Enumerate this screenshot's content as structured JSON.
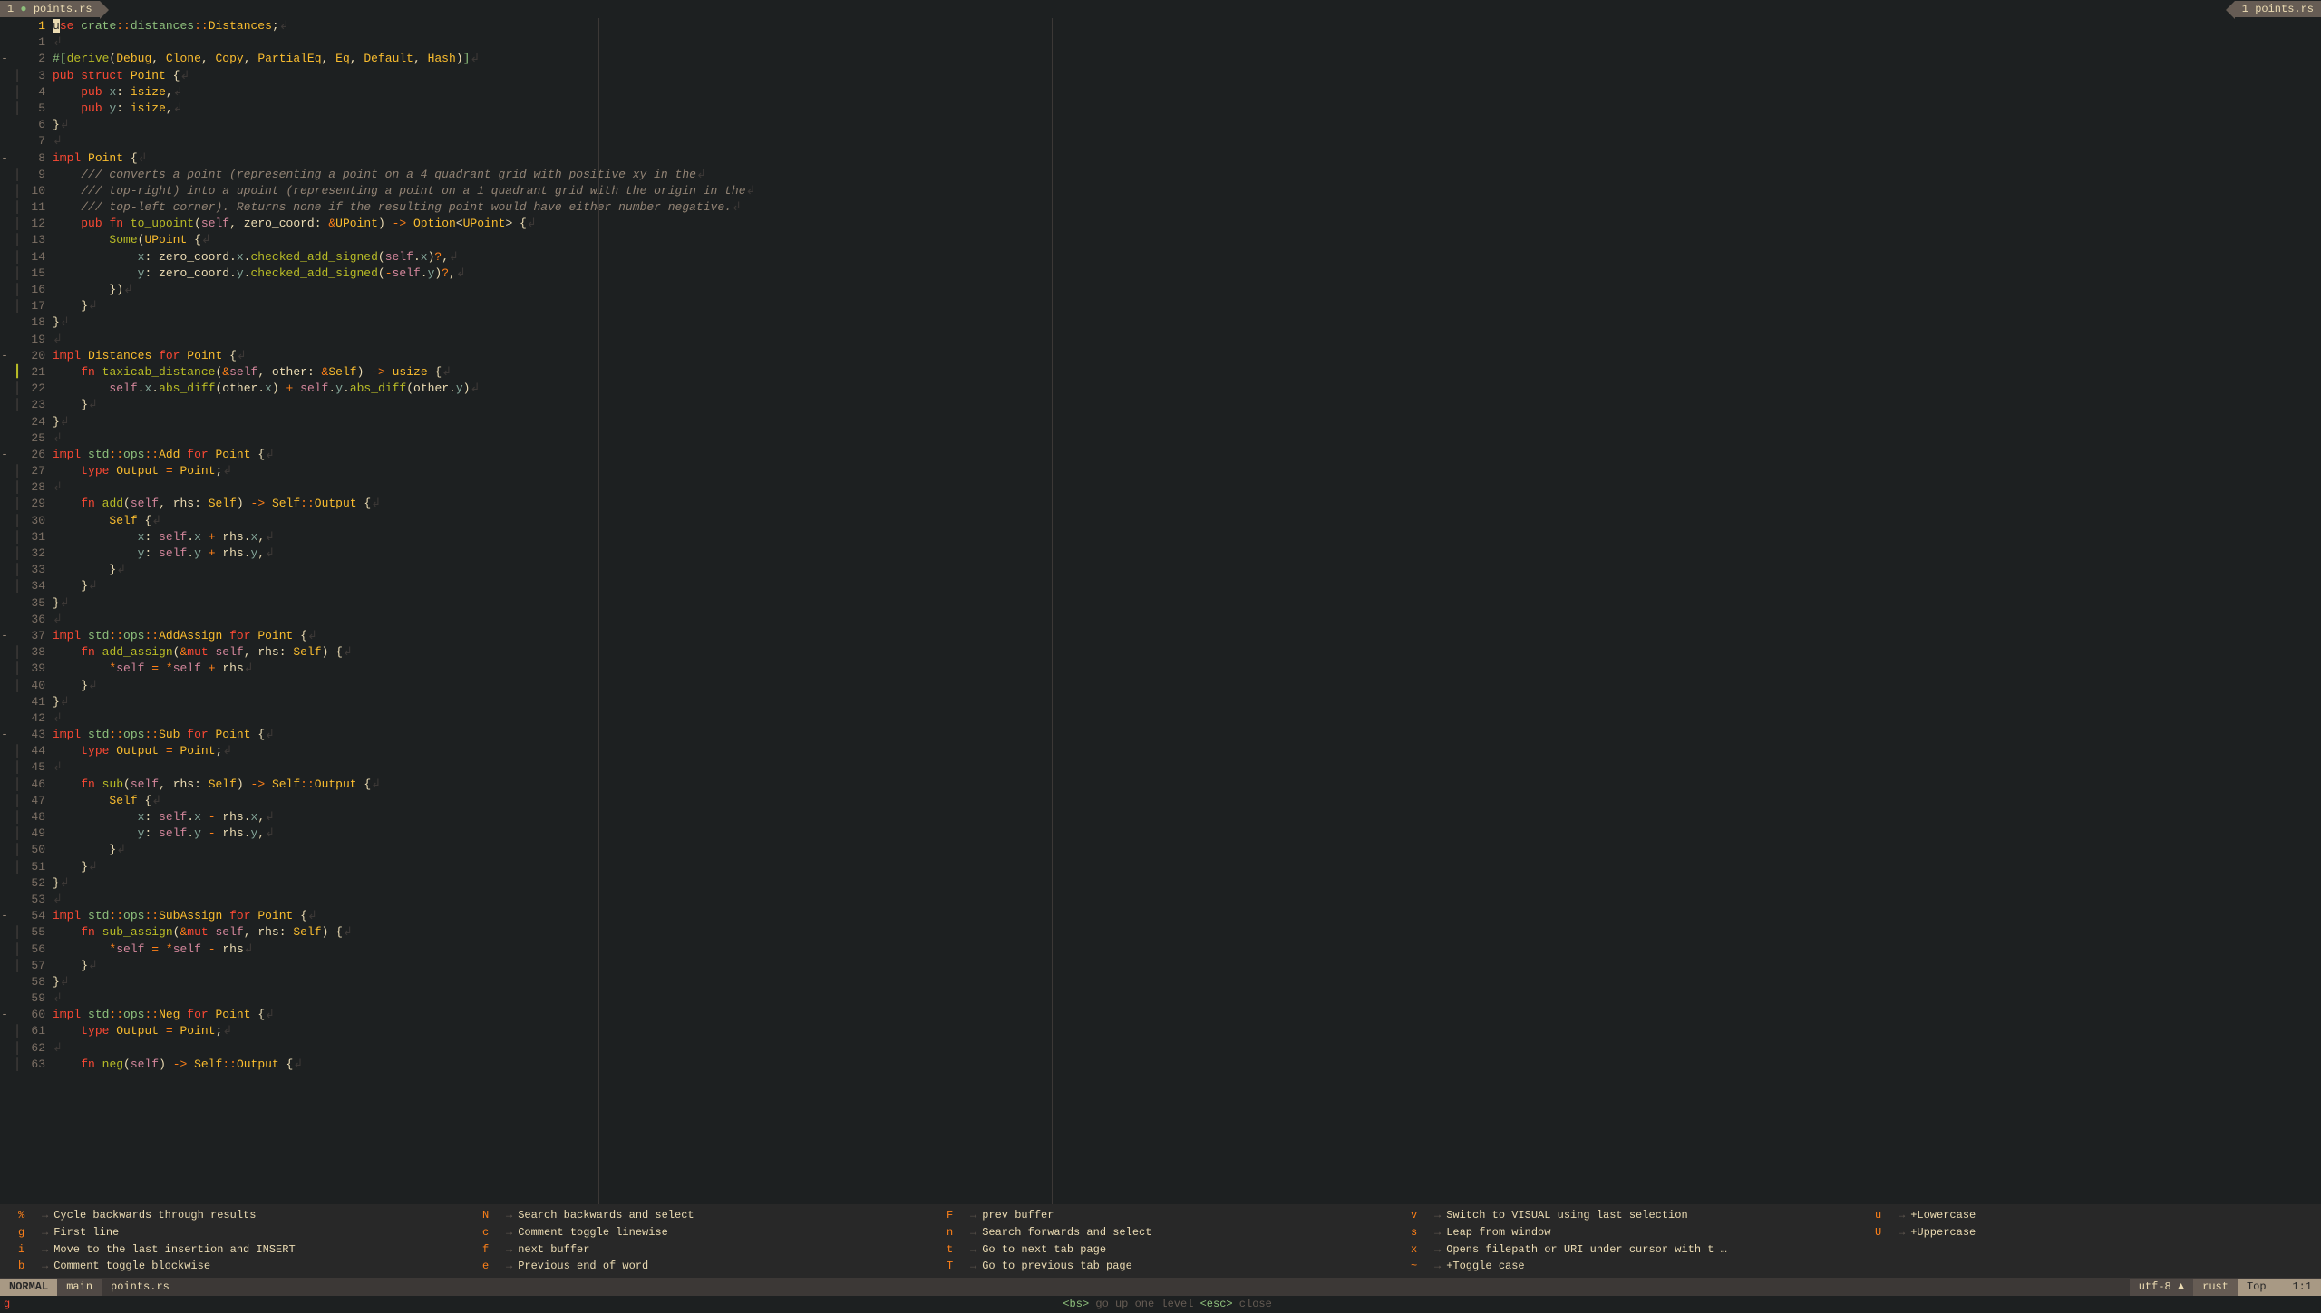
{
  "bufferline": {
    "left": {
      "index": "1",
      "modified": "●",
      "name": "points.rs"
    },
    "right": {
      "index": "1",
      "name": "points.rs"
    }
  },
  "code_lines": [
    {
      "n": 1,
      "fold": "",
      "sign": "",
      "html": "<span class='cursor-block'>u</span><span class='kw'>se</span> <span class='ns'>crate</span><span class='op'>::</span><span class='ns'>distances</span><span class='op'>::</span><span class='ty'>Distances</span>;<span class='ws'>↲</span>",
      "current": true
    },
    {
      "n": 1,
      "rel": true,
      "fold": "",
      "sign": "",
      "html": "<span class='ws'>↲</span>"
    },
    {
      "n": 2,
      "rel": true,
      "fold": "-",
      "sign": "",
      "html": "<span class='attr'>#[</span><span class='fn'>derive</span>(<span class='ty'>Debug</span>, <span class='ty'>Clone</span>, <span class='ty'>Copy</span>, <span class='ty'>PartialEq</span>, <span class='ty'>Eq</span>, <span class='ty'>Default</span>, <span class='ty'>Hash</span>)<span class='attr'>]</span><span class='ws'>↲</span>"
    },
    {
      "n": 3,
      "rel": true,
      "fold": "",
      "sign": "│",
      "html": "<span class='kw'>pub</span> <span class='kw'>struct</span> <span class='ty'>Point</span> {<span class='ws'>↲</span>"
    },
    {
      "n": 4,
      "rel": true,
      "fold": "",
      "sign": "│",
      "html": "    <span class='kw'>pub</span> <span class='prop'>x</span>: <span class='ty'>isize</span>,<span class='ws'>↲</span>"
    },
    {
      "n": 5,
      "rel": true,
      "fold": "",
      "sign": "│",
      "html": "    <span class='kw'>pub</span> <span class='prop'>y</span>: <span class='ty'>isize</span>,<span class='ws'>↲</span>"
    },
    {
      "n": 6,
      "rel": true,
      "fold": "",
      "sign": "",
      "html": "}<span class='ws'>↲</span>"
    },
    {
      "n": 7,
      "rel": true,
      "fold": "",
      "sign": "",
      "html": "<span class='ws'>↲</span>"
    },
    {
      "n": 8,
      "rel": true,
      "fold": "-",
      "sign": "",
      "html": "<span class='kw'>impl</span> <span class='ty'>Point</span> {<span class='ws'>↲</span>"
    },
    {
      "n": 9,
      "rel": true,
      "fold": "",
      "sign": "│",
      "html": "    <span class='comment'>/// converts a point (representing a point on a 4 quadrant grid with positive xy in the</span><span class='ws'>↲</span>"
    },
    {
      "n": 10,
      "rel": true,
      "fold": "",
      "sign": "│",
      "html": "    <span class='comment'>/// top-right) into a upoint (representing a point on a 1 quadrant grid with the origin in the</span><span class='ws'>↲</span>"
    },
    {
      "n": 11,
      "rel": true,
      "fold": "",
      "sign": "│",
      "html": "    <span class='comment'>/// top-left corner). Returns none if the resulting point would have either number negative.</span><span class='ws'>↲</span>"
    },
    {
      "n": 12,
      "rel": true,
      "fold": "",
      "sign": "│",
      "html": "    <span class='kw'>pub</span> <span class='kw'>fn</span> <span class='fn'>to_upoint</span>(<span class='self'>self</span>, <span class='param'>zero_coord</span>: <span class='op'>&</span><span class='ty'>UPoint</span>) <span class='op'>-&gt;</span> <span class='ty'>Option</span>&lt;<span class='ty'>UPoint</span>&gt; {<span class='ws'>↲</span>"
    },
    {
      "n": 13,
      "rel": true,
      "fold": "",
      "sign": "│",
      "html": "        <span class='fn'>Some</span>(<span class='ty'>UPoint</span> {<span class='ws'>↲</span>"
    },
    {
      "n": 14,
      "rel": true,
      "fold": "",
      "sign": "│",
      "html": "            <span class='prop'>x</span>: zero_coord.<span class='prop'>x</span>.<span class='fn'>checked_add_signed</span>(<span class='self'>self</span>.<span class='prop'>x</span>)<span class='op'>?</span>,<span class='ws'>↲</span>"
    },
    {
      "n": 15,
      "rel": true,
      "fold": "",
      "sign": "│",
      "html": "            <span class='prop'>y</span>: zero_coord.<span class='prop'>y</span>.<span class='fn'>checked_add_signed</span>(<span class='op'>-</span><span class='self'>self</span>.<span class='prop'>y</span>)<span class='op'>?</span>,<span class='ws'>↲</span>"
    },
    {
      "n": 16,
      "rel": true,
      "fold": "",
      "sign": "│",
      "html": "        })<span class='ws'>↲</span>"
    },
    {
      "n": 17,
      "rel": true,
      "fold": "",
      "sign": "│",
      "html": "    }<span class='ws'>↲</span>"
    },
    {
      "n": 18,
      "rel": true,
      "fold": "",
      "sign": "",
      "html": "}<span class='ws'>↲</span>"
    },
    {
      "n": 19,
      "rel": true,
      "fold": "",
      "sign": "",
      "html": "<span class='ws'>↲</span>"
    },
    {
      "n": 20,
      "rel": true,
      "fold": "-",
      "sign": "",
      "html": "<span class='kw'>impl</span> <span class='ty'>Distances</span> <span class='kw'>for</span> <span class='ty'>Point</span> {<span class='ws'>↲</span>"
    },
    {
      "n": 21,
      "rel": true,
      "fold": "",
      "sign": "┃",
      "sigclass": "git-add",
      "html": "    <span class='kw'>fn</span> <span class='fn'>taxicab_distance</span>(<span class='op'>&</span><span class='self'>self</span>, <span class='param'>other</span>: <span class='op'>&</span><span class='ty'>Self</span>) <span class='op'>-&gt;</span> <span class='ty'>usize</span> {<span class='ws'>↲</span>"
    },
    {
      "n": 22,
      "rel": true,
      "fold": "",
      "sign": "│",
      "html": "        <span class='self'>self</span>.<span class='prop'>x</span>.<span class='fn'>abs_diff</span>(other.<span class='prop'>x</span>) <span class='op'>+</span> <span class='self'>self</span>.<span class='prop'>y</span>.<span class='fn'>abs_diff</span>(other.<span class='prop'>y</span>)<span class='ws'>↲</span>"
    },
    {
      "n": 23,
      "rel": true,
      "fold": "",
      "sign": "│",
      "html": "    }<span class='ws'>↲</span>"
    },
    {
      "n": 24,
      "rel": true,
      "fold": "",
      "sign": "",
      "html": "}<span class='ws'>↲</span>"
    },
    {
      "n": 25,
      "rel": true,
      "fold": "",
      "sign": "",
      "html": "<span class='ws'>↲</span>"
    },
    {
      "n": 26,
      "rel": true,
      "fold": "-",
      "sign": "",
      "html": "<span class='kw'>impl</span> <span class='ns'>std</span><span class='op'>::</span><span class='ns'>ops</span><span class='op'>::</span><span class='ty'>Add</span> <span class='kw'>for</span> <span class='ty'>Point</span> {<span class='ws'>↲</span>"
    },
    {
      "n": 27,
      "rel": true,
      "fold": "",
      "sign": "│",
      "html": "    <span class='kw'>type</span> <span class='ty'>Output</span> <span class='op'>=</span> <span class='ty'>Point</span>;<span class='ws'>↲</span>"
    },
    {
      "n": 28,
      "rel": true,
      "fold": "",
      "sign": "│",
      "html": "<span class='ws'>↲</span>"
    },
    {
      "n": 29,
      "rel": true,
      "fold": "",
      "sign": "│",
      "html": "    <span class='kw'>fn</span> <span class='fn'>add</span>(<span class='self'>self</span>, <span class='param'>rhs</span>: <span class='ty'>Self</span>) <span class='op'>-&gt;</span> <span class='ty'>Self</span><span class='op'>::</span><span class='ty'>Output</span> {<span class='ws'>↲</span>"
    },
    {
      "n": 30,
      "rel": true,
      "fold": "",
      "sign": "│",
      "html": "        <span class='ty'>Self</span> {<span class='ws'>↲</span>"
    },
    {
      "n": 31,
      "rel": true,
      "fold": "",
      "sign": "│",
      "html": "            <span class='prop'>x</span>: <span class='self'>self</span>.<span class='prop'>x</span> <span class='op'>+</span> rhs.<span class='prop'>x</span>,<span class='ws'>↲</span>"
    },
    {
      "n": 32,
      "rel": true,
      "fold": "",
      "sign": "│",
      "html": "            <span class='prop'>y</span>: <span class='self'>self</span>.<span class='prop'>y</span> <span class='op'>+</span> rhs.<span class='prop'>y</span>,<span class='ws'>↲</span>"
    },
    {
      "n": 33,
      "rel": true,
      "fold": "",
      "sign": "│",
      "html": "        }<span class='ws'>↲</span>"
    },
    {
      "n": 34,
      "rel": true,
      "fold": "",
      "sign": "│",
      "html": "    }<span class='ws'>↲</span>"
    },
    {
      "n": 35,
      "rel": true,
      "fold": "",
      "sign": "",
      "html": "}<span class='ws'>↲</span>"
    },
    {
      "n": 36,
      "rel": true,
      "fold": "",
      "sign": "",
      "html": "<span class='ws'>↲</span>"
    },
    {
      "n": 37,
      "rel": true,
      "fold": "-",
      "sign": "",
      "html": "<span class='kw'>impl</span> <span class='ns'>std</span><span class='op'>::</span><span class='ns'>ops</span><span class='op'>::</span><span class='ty'>AddAssign</span> <span class='kw'>for</span> <span class='ty'>Point</span> {<span class='ws'>↲</span>"
    },
    {
      "n": 38,
      "rel": true,
      "fold": "",
      "sign": "│",
      "html": "    <span class='kw'>fn</span> <span class='fn'>add_assign</span>(<span class='op'>&</span><span class='kw'>mut</span> <span class='self'>self</span>, <span class='param'>rhs</span>: <span class='ty'>Self</span>) {<span class='ws'>↲</span>"
    },
    {
      "n": 39,
      "rel": true,
      "fold": "",
      "sign": "│",
      "html": "        <span class='op'>*</span><span class='self'>self</span> <span class='op'>=</span> <span class='op'>*</span><span class='self'>self</span> <span class='op'>+</span> rhs<span class='ws'>↲</span>"
    },
    {
      "n": 40,
      "rel": true,
      "fold": "",
      "sign": "│",
      "html": "    }<span class='ws'>↲</span>"
    },
    {
      "n": 41,
      "rel": true,
      "fold": "",
      "sign": "",
      "html": "}<span class='ws'>↲</span>"
    },
    {
      "n": 42,
      "rel": true,
      "fold": "",
      "sign": "",
      "html": "<span class='ws'>↲</span>"
    },
    {
      "n": 43,
      "rel": true,
      "fold": "-",
      "sign": "",
      "html": "<span class='kw'>impl</span> <span class='ns'>std</span><span class='op'>::</span><span class='ns'>ops</span><span class='op'>::</span><span class='ty'>Sub</span> <span class='kw'>for</span> <span class='ty'>Point</span> {<span class='ws'>↲</span>"
    },
    {
      "n": 44,
      "rel": true,
      "fold": "",
      "sign": "│",
      "html": "    <span class='kw'>type</span> <span class='ty'>Output</span> <span class='op'>=</span> <span class='ty'>Point</span>;<span class='ws'>↲</span>"
    },
    {
      "n": 45,
      "rel": true,
      "fold": "",
      "sign": "│",
      "html": "<span class='ws'>↲</span>"
    },
    {
      "n": 46,
      "rel": true,
      "fold": "",
      "sign": "│",
      "html": "    <span class='kw'>fn</span> <span class='fn'>sub</span>(<span class='self'>self</span>, <span class='param'>rhs</span>: <span class='ty'>Self</span>) <span class='op'>-&gt;</span> <span class='ty'>Self</span><span class='op'>::</span><span class='ty'>Output</span> {<span class='ws'>↲</span>"
    },
    {
      "n": 47,
      "rel": true,
      "fold": "",
      "sign": "│",
      "html": "        <span class='ty'>Self</span> {<span class='ws'>↲</span>"
    },
    {
      "n": 48,
      "rel": true,
      "fold": "",
      "sign": "│",
      "html": "            <span class='prop'>x</span>: <span class='self'>self</span>.<span class='prop'>x</span> <span class='op'>-</span> rhs.<span class='prop'>x</span>,<span class='ws'>↲</span>"
    },
    {
      "n": 49,
      "rel": true,
      "fold": "",
      "sign": "│",
      "html": "            <span class='prop'>y</span>: <span class='self'>self</span>.<span class='prop'>y</span> <span class='op'>-</span> rhs.<span class='prop'>y</span>,<span class='ws'>↲</span>"
    },
    {
      "n": 50,
      "rel": true,
      "fold": "",
      "sign": "│",
      "html": "        }<span class='ws'>↲</span>"
    },
    {
      "n": 51,
      "rel": true,
      "fold": "",
      "sign": "│",
      "html": "    }<span class='ws'>↲</span>"
    },
    {
      "n": 52,
      "rel": true,
      "fold": "",
      "sign": "",
      "html": "}<span class='ws'>↲</span>"
    },
    {
      "n": 53,
      "rel": true,
      "fold": "",
      "sign": "",
      "html": "<span class='ws'>↲</span>"
    },
    {
      "n": 54,
      "rel": true,
      "fold": "-",
      "sign": "",
      "html": "<span class='kw'>impl</span> <span class='ns'>std</span><span class='op'>::</span><span class='ns'>ops</span><span class='op'>::</span><span class='ty'>SubAssign</span> <span class='kw'>for</span> <span class='ty'>Point</span> {<span class='ws'>↲</span>"
    },
    {
      "n": 55,
      "rel": true,
      "fold": "",
      "sign": "│",
      "html": "    <span class='kw'>fn</span> <span class='fn'>sub_assign</span>(<span class='op'>&</span><span class='kw'>mut</span> <span class='self'>self</span>, <span class='param'>rhs</span>: <span class='ty'>Self</span>) {<span class='ws'>↲</span>"
    },
    {
      "n": 56,
      "rel": true,
      "fold": "",
      "sign": "│",
      "html": "        <span class='op'>*</span><span class='self'>self</span> <span class='op'>=</span> <span class='op'>*</span><span class='self'>self</span> <span class='op'>-</span> rhs<span class='ws'>↲</span>"
    },
    {
      "n": 57,
      "rel": true,
      "fold": "",
      "sign": "│",
      "html": "    }<span class='ws'>↲</span>"
    },
    {
      "n": 58,
      "rel": true,
      "fold": "",
      "sign": "",
      "html": "}<span class='ws'>↲</span>"
    },
    {
      "n": 59,
      "rel": true,
      "fold": "",
      "sign": "",
      "html": "<span class='ws'>↲</span>"
    },
    {
      "n": 60,
      "rel": true,
      "fold": "-",
      "sign": "",
      "html": "<span class='kw'>impl</span> <span class='ns'>std</span><span class='op'>::</span><span class='ns'>ops</span><span class='op'>::</span><span class='ty'>Neg</span> <span class='kw'>for</span> <span class='ty'>Point</span> {<span class='ws'>↲</span>"
    },
    {
      "n": 61,
      "rel": true,
      "fold": "",
      "sign": "│",
      "html": "    <span class='kw'>type</span> <span class='ty'>Output</span> <span class='op'>=</span> <span class='ty'>Point</span>;<span class='ws'>↲</span>"
    },
    {
      "n": 62,
      "rel": true,
      "fold": "",
      "sign": "│",
      "html": "<span class='ws'>↲</span>"
    },
    {
      "n": 63,
      "rel": true,
      "fold": "",
      "sign": "│",
      "html": "    <span class='kw'>fn</span> <span class='fn'>neg</span>(<span class='self'>self</span>) <span class='op'>-&gt;</span> <span class='ty'>Self</span><span class='op'>::</span><span class='ty'>Output</span> {<span class='ws'>↲</span>"
    }
  ],
  "whichkey": [
    {
      "k": "%",
      "d": "Cycle backwards through results"
    },
    {
      "k": "N",
      "d": "Search backwards and select"
    },
    {
      "k": "F",
      "d": "prev buffer"
    },
    {
      "k": "v",
      "d": "Switch to VISUAL using last selection"
    },
    {
      "k": "u",
      "d": "+Lowercase"
    },
    {
      "k": "g",
      "d": "First line"
    },
    {
      "k": "c",
      "d": "Comment toggle linewise"
    },
    {
      "k": "n",
      "d": "Search forwards and select"
    },
    {
      "k": "s",
      "d": "Leap from window"
    },
    {
      "k": "U",
      "d": "+Uppercase"
    },
    {
      "k": "i",
      "d": "Move to the last insertion and INSERT"
    },
    {
      "k": "f",
      "d": "next buffer"
    },
    {
      "k": "t",
      "d": "Go to next tab page"
    },
    {
      "k": "x",
      "d": "Opens filepath or URI under cursor with t …"
    },
    {
      "k": "",
      "d": ""
    },
    {
      "k": "b",
      "d": "Comment toggle blockwise"
    },
    {
      "k": "e",
      "d": "Previous end of word"
    },
    {
      "k": "T",
      "d": "Go to previous tab page"
    },
    {
      "k": "~",
      "d": "+Toggle case"
    },
    {
      "k": "",
      "d": ""
    }
  ],
  "statusline": {
    "mode": "NORMAL",
    "branch_icon": "",
    "branch": "main",
    "file": "points.rs",
    "encoding": "utf-8",
    "nav_icons": " ▲  ",
    "lang_icon": "",
    "lang": "rust",
    "pos_label": "Top",
    "pos": "1:1"
  },
  "cmdline": {
    "prefix": "g",
    "hint_html": "<span class='key'>&lt;bs&gt;</span> go up one level <span class='key'>&lt;esc&gt;</span> close"
  }
}
